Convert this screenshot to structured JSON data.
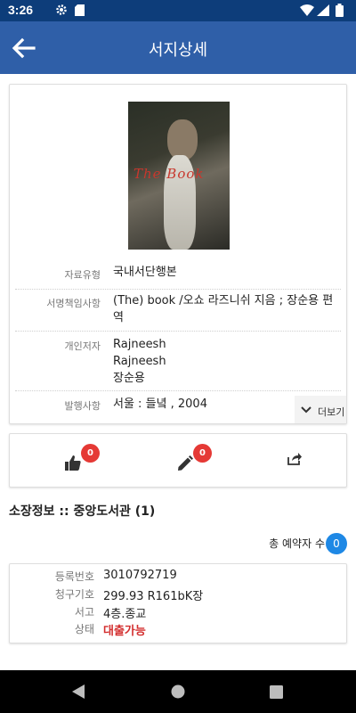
{
  "status_bar": {
    "time": "3:26"
  },
  "app_bar": {
    "title": "서지상세"
  },
  "cover": {
    "title_text": "The Book"
  },
  "detail": {
    "rows": [
      {
        "label": "자료유형",
        "value": "국내서단행본"
      },
      {
        "label": "서명책임사항",
        "value": "(The) book  /오쇼 라즈니쉬 지음 ; 장순용 편역"
      },
      {
        "label": "개인저자",
        "values": [
          "Rajneesh",
          "Rajneesh",
          "장순용"
        ]
      },
      {
        "label": "발행사항",
        "value": "서울  : 들녘 , 2004"
      }
    ],
    "more_label": "더보기"
  },
  "actions": {
    "like_count": "0",
    "review_count": "0"
  },
  "holdings": {
    "title": "소장정보 :: 중앙도서관 (1)",
    "reserve_label": "총 예약자 수",
    "reserve_count": "0",
    "item": {
      "reg_no_label": "등록번호",
      "reg_no": "3010792719",
      "call_no_label": "청구기호",
      "call_no": "299.93 R161bK장",
      "location_label": "서고",
      "location": "4층.종교",
      "status_label": "상태",
      "status": "대출가능"
    }
  },
  "colors": {
    "app_bar": "#2f5fa8",
    "status_bar": "#0d3d7a",
    "badge": "#e53935",
    "reserve": "#1e88e5",
    "available": "#d32f2f"
  }
}
